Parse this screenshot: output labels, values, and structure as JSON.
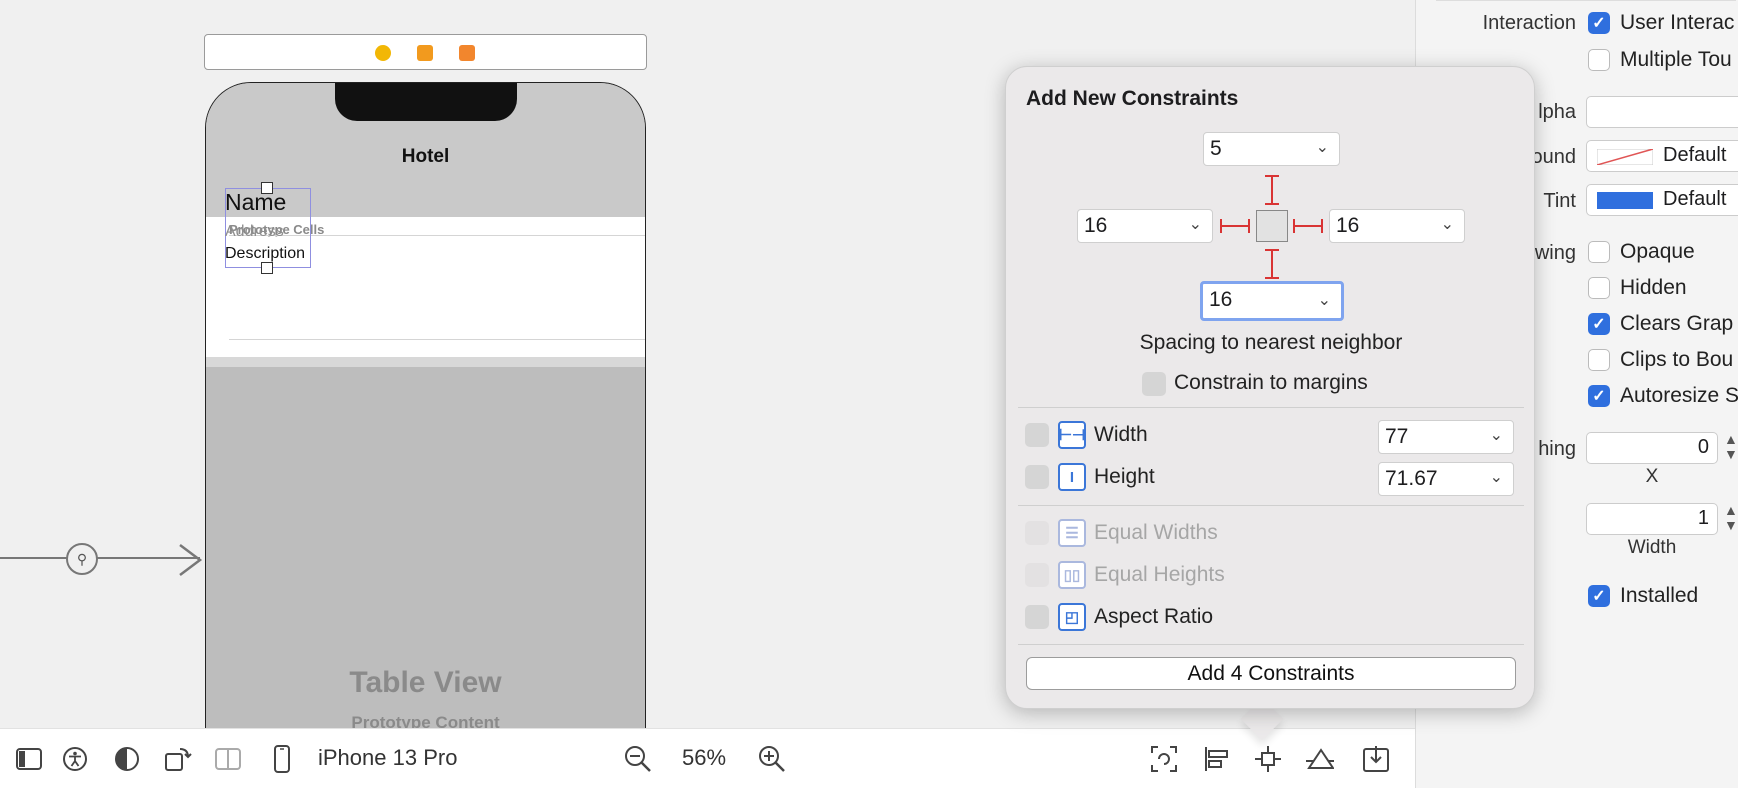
{
  "canvas": {
    "nav_title": "Hotel",
    "prototype_label": "Prototype Cells",
    "cell": {
      "name": "Name",
      "address": "Address",
      "description": "Description"
    },
    "table_title": "Table View",
    "table_subtitle": "Prototype Content",
    "scene_icons": [
      "view-controller-icon",
      "first-responder-icon",
      "exit-icon"
    ],
    "scene_colors": [
      "#f2b705",
      "#f29a1e",
      "#f2862d"
    ]
  },
  "toolbar": {
    "device": "iPhone 13 Pro",
    "zoom": "56%"
  },
  "popover": {
    "title": "Add New Constraints",
    "top_value": "5",
    "left_value": "16",
    "right_value": "16",
    "bottom_value": "16",
    "spacing_caption": "Spacing to nearest neighbor",
    "constrain_margins": "Constrain to margins",
    "width_label": "Width",
    "width_value": "77",
    "height_label": "Height",
    "height_value": "71.67",
    "equal_widths": "Equal Widths",
    "equal_heights": "Equal Heights",
    "aspect_ratio": "Aspect Ratio",
    "add_button": "Add 4 Constraints"
  },
  "inspector": {
    "interaction_label": "Interaction",
    "user_interaction": "User Interac",
    "multiple_touch": "Multiple Tou",
    "alpha_label": "lpha",
    "background_label": "ound",
    "background_value": "Default",
    "tint_label": "Tint",
    "tint_value": "Default",
    "drawing_label": "wing",
    "opaque": "Opaque",
    "hidden": "Hidden",
    "clears_graphics": "Clears Grap",
    "clips_bounds": "Clips to Bou",
    "autoresize": "Autoresize S",
    "stretching_label": "hing",
    "stretch_x_value": "0",
    "stretch_x_caption": "X",
    "stretch_w_value": "1",
    "stretch_w_caption": "Width",
    "installed": "Installed",
    "tint_color": "#2f6fde"
  }
}
